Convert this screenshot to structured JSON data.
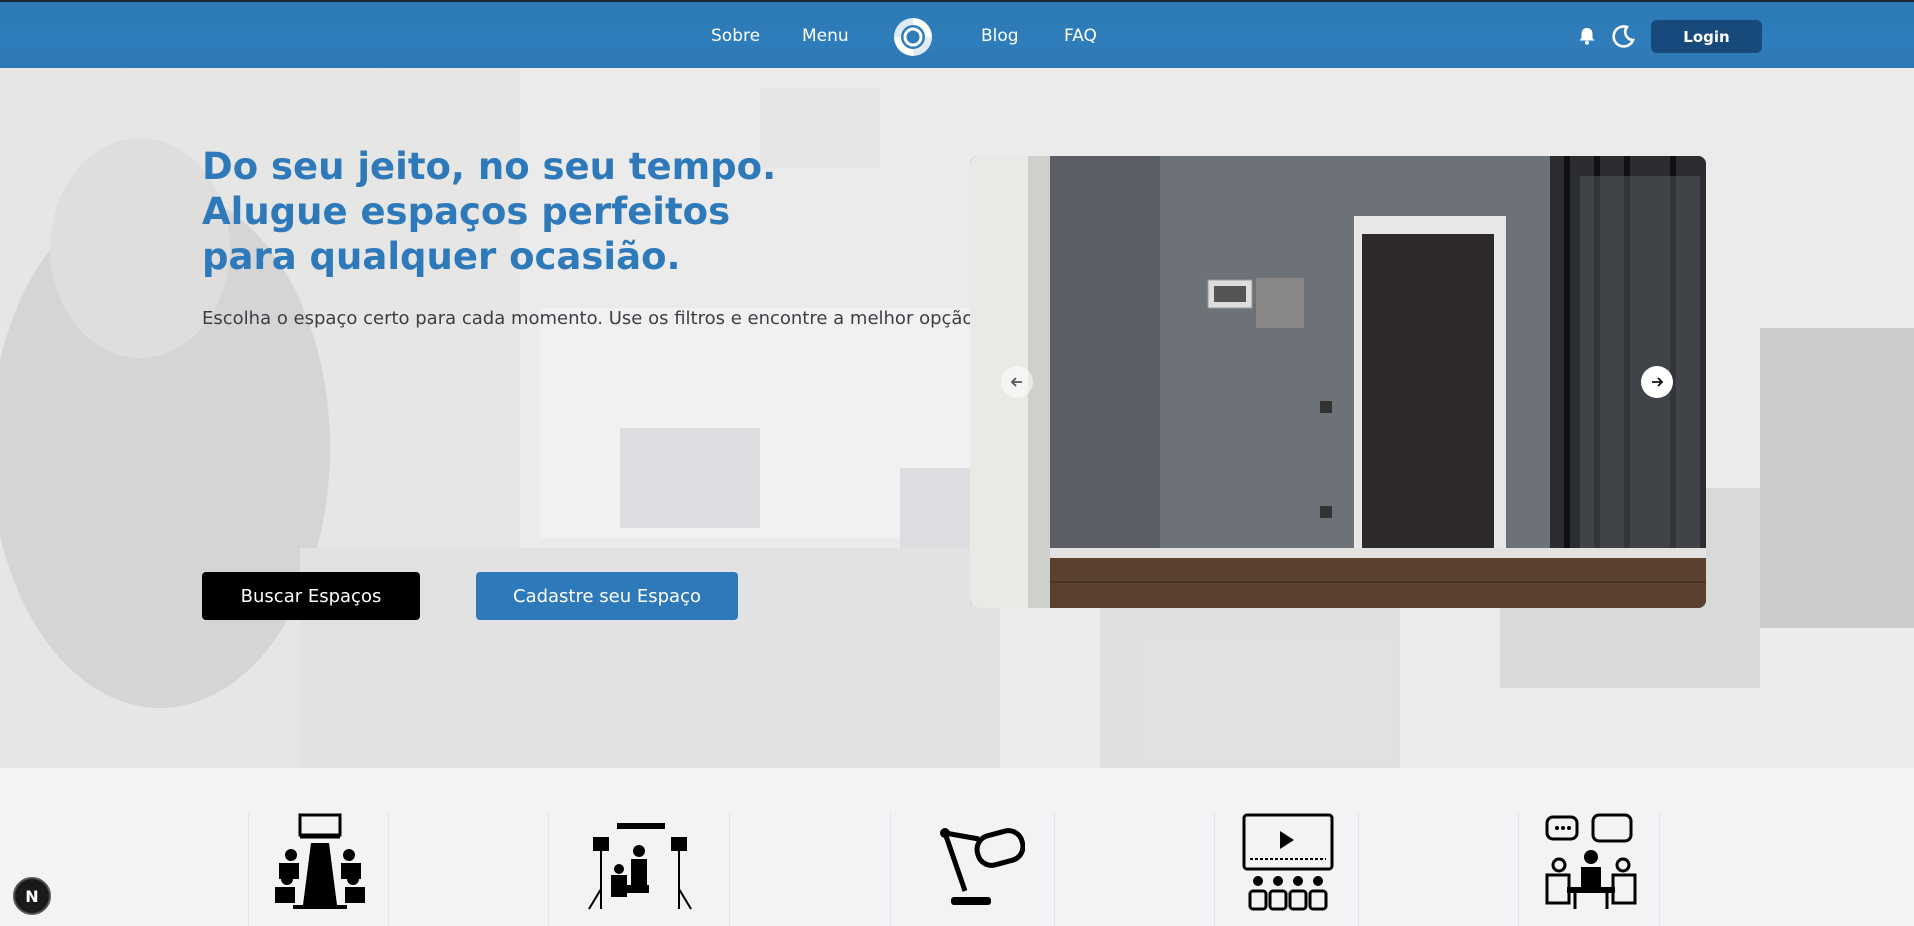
{
  "navbar": {
    "links": [
      "Sobre",
      "Menu",
      "Blog",
      "FAQ"
    ],
    "login_label": "Login",
    "icons": [
      "logo-icon",
      "bell-icon",
      "moon-icon"
    ]
  },
  "hero": {
    "title_lines": [
      "Do seu jeito, no seu tempo.",
      "Alugue espaços perfeitos",
      "para qualquer ocasião."
    ],
    "subtitle": "Escolha o espaço certo para cada momento. Use os filtros e encontre a melhor opção!",
    "buttons": {
      "search_label": "Buscar Espaços",
      "register_label": "Cadastre seu Espaço"
    },
    "carousel": {
      "prev_icon": "arrow-left-icon",
      "next_icon": "arrow-right-icon"
    }
  },
  "categories": {
    "icons": [
      "meeting-room-icon",
      "photo-studio-icon",
      "podcast-microphone-icon",
      "video-auditorium-icon",
      "discussion-group-icon"
    ]
  },
  "colors": {
    "brand_blue": "#2d79ba",
    "login_dark": "#17497a",
    "black_button": "#000000"
  },
  "badge": {
    "letter": "N"
  }
}
